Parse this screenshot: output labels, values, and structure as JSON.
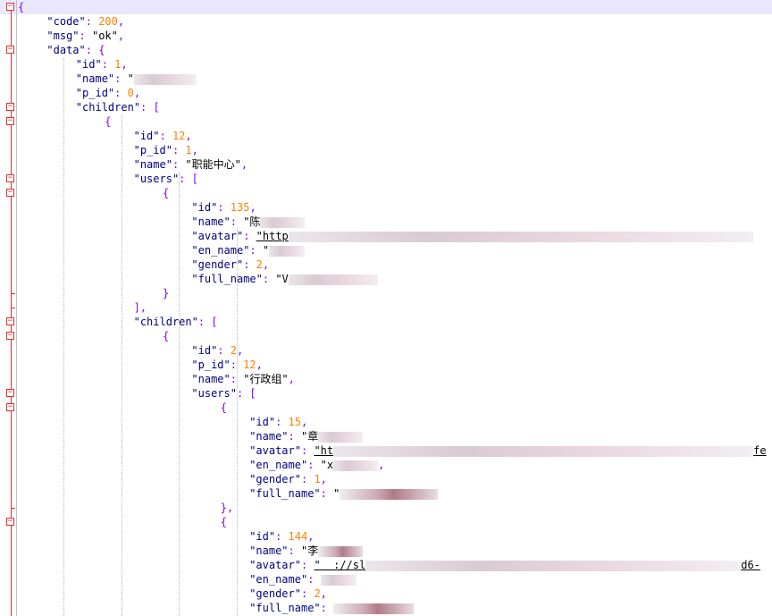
{
  "editor": {
    "colors": {
      "key": "#000080",
      "string": "#000000",
      "number": "#ff8000",
      "punct": "#8000ff",
      "fold": "#e03030"
    },
    "lines": [
      {
        "indent": 0,
        "text": "{",
        "fold": "open"
      },
      {
        "indent": 2,
        "key": "\"code\"",
        "num": "200",
        "tail": ","
      },
      {
        "indent": 2,
        "key": "\"msg\"",
        "str": "\"ok\"",
        "tail": ","
      },
      {
        "indent": 2,
        "key": "\"data\"",
        "open": "{",
        "fold": "open"
      },
      {
        "indent": 4,
        "key": "\"id\"",
        "num": "1",
        "tail": ","
      },
      {
        "indent": 4,
        "key": "\"name\"",
        "str": "\"",
        "blur": 70
      },
      {
        "indent": 4,
        "key": "\"p_id\"",
        "num": "0",
        "tail": ","
      },
      {
        "indent": 4,
        "key": "\"children\"",
        "open": "[",
        "fold": "open"
      },
      {
        "indent": 6,
        "text": "{",
        "fold": "open"
      },
      {
        "indent": 8,
        "key": "\"id\"",
        "num": "12",
        "tail": ","
      },
      {
        "indent": 8,
        "key": "\"p_id\"",
        "num": "1",
        "tail": ","
      },
      {
        "indent": 8,
        "key": "\"name\"",
        "str": "\"职能中心\"",
        "tail": ","
      },
      {
        "indent": 8,
        "key": "\"users\"",
        "open": "[",
        "fold": "open"
      },
      {
        "indent": 10,
        "text": "{",
        "fold": "open"
      },
      {
        "indent": 12,
        "key": "\"id\"",
        "num": "135",
        "tail": ","
      },
      {
        "indent": 12,
        "key": "\"name\"",
        "str": "\"陈",
        "blur": 50
      },
      {
        "indent": 12,
        "key": "\"avatar\"",
        "str": "\"http",
        "blur": 520,
        "underline": true
      },
      {
        "indent": 12,
        "key": "\"en_name\"",
        "str": "\"",
        "blur": 40
      },
      {
        "indent": 12,
        "key": "\"gender\"",
        "num": "2",
        "tail": ","
      },
      {
        "indent": 12,
        "key": "\"full_name\"",
        "str": "\"V",
        "blur": 100
      },
      {
        "indent": 10,
        "text": "}",
        "fold": "end"
      },
      {
        "indent": 8,
        "text": "],",
        "fold": "end"
      },
      {
        "indent": 8,
        "key": "\"children\"",
        "open": "[",
        "fold": "open"
      },
      {
        "indent": 10,
        "text": "{",
        "fold": "open"
      },
      {
        "indent": 12,
        "key": "\"id\"",
        "num": "2",
        "tail": ","
      },
      {
        "indent": 12,
        "key": "\"p_id\"",
        "num": "12",
        "tail": ","
      },
      {
        "indent": 12,
        "key": "\"name\"",
        "str": "\"行政组\"",
        "tail": ","
      },
      {
        "indent": 12,
        "key": "\"users\"",
        "open": "[",
        "fold": "open"
      },
      {
        "indent": 14,
        "text": "{",
        "fold": "open"
      },
      {
        "indent": 16,
        "key": "\"id\"",
        "num": "15",
        "tail": ","
      },
      {
        "indent": 16,
        "key": "\"name\"",
        "str": "\"章",
        "blur": 50
      },
      {
        "indent": 16,
        "key": "\"avatar\"",
        "str": "\"ht",
        "blur": 470,
        "underline": true,
        "after": "fe"
      },
      {
        "indent": 16,
        "key": "\"en_name\"",
        "str": "\"x",
        "blur": 50,
        "tail": ","
      },
      {
        "indent": 16,
        "key": "\"gender\"",
        "num": "1",
        "tail": ","
      },
      {
        "indent": 16,
        "key": "\"full_name\"",
        "str": "\"",
        "blur": 110,
        "dark": true
      },
      {
        "indent": 14,
        "text": "},",
        "fold": "end"
      },
      {
        "indent": 14,
        "text": "{",
        "fold": "open"
      },
      {
        "indent": 16,
        "key": "\"id\"",
        "num": "144",
        "tail": ","
      },
      {
        "indent": 16,
        "key": "\"name\"",
        "str": "\"李",
        "blur": 50,
        "dark": true
      },
      {
        "indent": 16,
        "key": "\"avatar\"",
        "str": "\"  ://sl",
        "blur": 420,
        "underline": true,
        "after": "d6-"
      },
      {
        "indent": 16,
        "key": "\"en_name\"",
        "str": "",
        "blur": 40
      },
      {
        "indent": 16,
        "key": "\"gender\"",
        "num": "2",
        "tail": ","
      },
      {
        "indent": 16,
        "key": "\"full_name\"",
        "str": "",
        "blur": 90,
        "dark": true
      }
    ]
  }
}
